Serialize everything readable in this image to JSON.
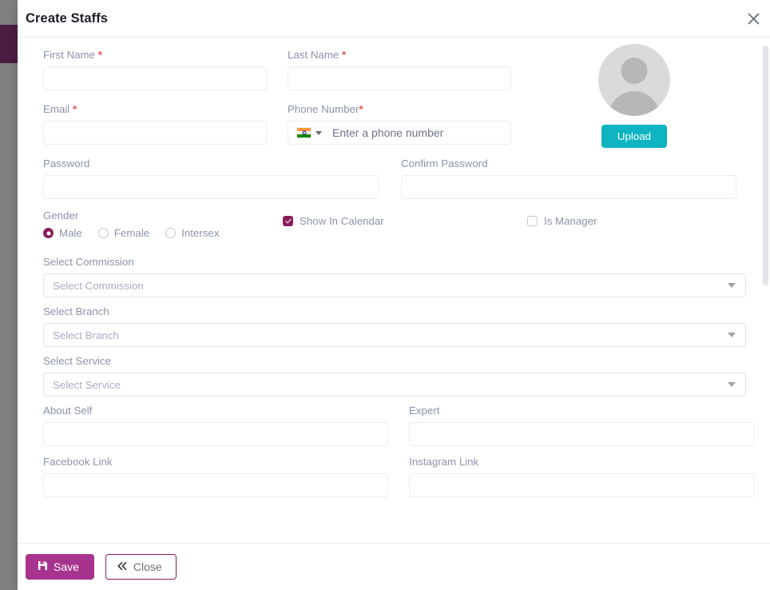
{
  "modal": {
    "title": "Create Staffs",
    "close_icon": "close-x-icon"
  },
  "avatar": {
    "icon": "user-avatar-placeholder-icon",
    "upload_label": "Upload"
  },
  "fields": {
    "first_name": {
      "label": "First Name",
      "required": "*",
      "value": "",
      "placeholder": ""
    },
    "last_name": {
      "label": "Last Name",
      "required": "*",
      "value": "",
      "placeholder": ""
    },
    "email": {
      "label": "Email",
      "required": "*",
      "value": "",
      "placeholder": ""
    },
    "phone": {
      "label": "Phone Number",
      "required": "*",
      "value": "",
      "placeholder": "Enter a phone number",
      "country_flag": "india-flag-icon",
      "country_caret": "caret-down-icon"
    },
    "password": {
      "label": "Password",
      "value": "",
      "placeholder": ""
    },
    "confirm_password": {
      "label": "Confirm Password",
      "value": "",
      "placeholder": ""
    },
    "about_self": {
      "label": "About Self",
      "value": "",
      "placeholder": ""
    },
    "expert": {
      "label": "Expert",
      "value": "",
      "placeholder": ""
    },
    "facebook_link": {
      "label": "Facebook Link",
      "value": "",
      "placeholder": ""
    },
    "instagram_link": {
      "label": "Instagram Link",
      "value": "",
      "placeholder": ""
    }
  },
  "gender": {
    "label": "Gender",
    "options": [
      {
        "label": "Male",
        "checked": true
      },
      {
        "label": "Female",
        "checked": false
      },
      {
        "label": "Intersex",
        "checked": false
      }
    ]
  },
  "checkboxes": {
    "show_in_calendar": {
      "label": "Show In Calendar",
      "checked": true
    },
    "is_manager": {
      "label": "Is Manager",
      "checked": false
    }
  },
  "selects": {
    "commission": {
      "label": "Select Commission",
      "selected": "Select Commission",
      "caret": "caret-down-icon"
    },
    "branch": {
      "label": "Select Branch",
      "selected": "Select Branch",
      "caret": "caret-down-icon"
    },
    "service": {
      "label": "Select Service",
      "selected": "Select Service",
      "caret": "caret-down-icon"
    }
  },
  "footer": {
    "save_label": "Save",
    "save_icon": "floppy-save-icon",
    "close_label": "Close",
    "close_icon": "double-chevron-left-icon"
  },
  "colors": {
    "accent_purple": "#8c1d5b",
    "save_button": "#a8338f",
    "upload_teal": "#0eb4c1",
    "required_red": "#e8564a",
    "label_gray": "#8b93a8",
    "border_gray": "#e9ecef",
    "sidebar_active": "#4d1c42",
    "backdrop_gray": "#808080"
  }
}
